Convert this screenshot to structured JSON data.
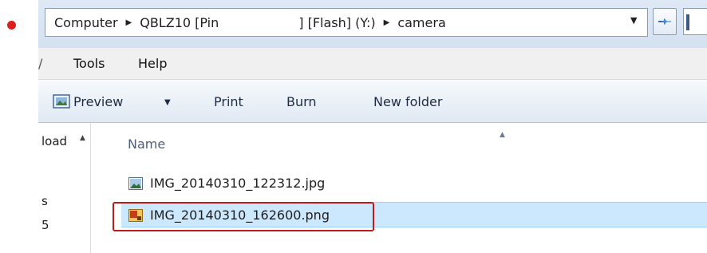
{
  "address": {
    "crumbs": [
      "Computer",
      "QBLZ10 [Pin",
      "] [Flash] (Y:)",
      "camera"
    ]
  },
  "menu": {
    "items": [
      "Tools",
      "Help"
    ],
    "edge_fragment": "/"
  },
  "toolbar": {
    "preview": "Preview",
    "print": "Print",
    "burn": "Burn",
    "new_folder": "New folder"
  },
  "navpane": {
    "item1": "load",
    "item2": "s",
    "item3": "5"
  },
  "list": {
    "column_name": "Name",
    "files": [
      {
        "name": "IMG_20140310_122312.jpg",
        "icon": "jpg-image-icon",
        "selected": false
      },
      {
        "name": "IMG_20140310_162600.png",
        "icon": "png-image-icon",
        "selected": true
      }
    ]
  },
  "colors": {
    "selection": "#cce8ff",
    "highlight_box": "#c0191e",
    "bullet": "#d9201c"
  }
}
